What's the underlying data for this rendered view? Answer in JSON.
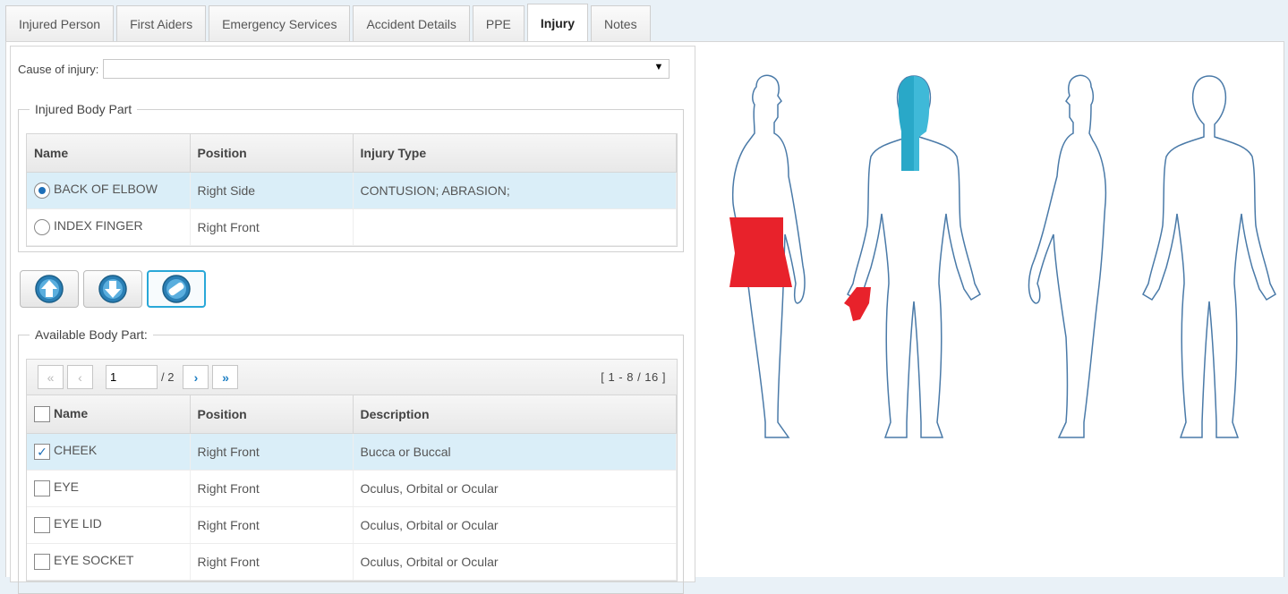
{
  "tabs": [
    {
      "label": "Injured Person"
    },
    {
      "label": "First Aiders"
    },
    {
      "label": "Emergency Services"
    },
    {
      "label": "Accident Details"
    },
    {
      "label": "PPE"
    },
    {
      "label": "Injury"
    },
    {
      "label": "Notes"
    }
  ],
  "cause": {
    "label": "Cause of injury:",
    "value": ""
  },
  "injured": {
    "legend": "Injured Body Part",
    "columns": [
      "Name",
      "Position",
      "Injury Type"
    ],
    "rows": [
      {
        "name": "BACK OF ELBOW",
        "position": "Right Side",
        "type": "CONTUSION; ABRASION;"
      },
      {
        "name": "INDEX FINGER",
        "position": "Right Front",
        "type": ""
      }
    ]
  },
  "buttons": {
    "up": "move-up",
    "down": "move-down",
    "edit": "edit"
  },
  "available": {
    "legend": "Available Body Part:",
    "pager": {
      "page": "1",
      "total": "/ 2",
      "range": "[ 1 - 8 / 16 ]"
    },
    "columns": [
      "Name",
      "Position",
      "Description"
    ],
    "rows": [
      {
        "name": "CHEEK",
        "position": "Right Front",
        "desc": "Bucca or Buccal"
      },
      {
        "name": "EYE",
        "position": "Right Front",
        "desc": "Oculus, Orbital or Ocular"
      },
      {
        "name": "EYE LID",
        "position": "Right Front",
        "desc": "Oculus, Orbital or Ocular"
      },
      {
        "name": "EYE SOCKET",
        "position": "Right Front",
        "desc": "Oculus, Orbital or Ocular"
      }
    ]
  },
  "colors": {
    "injured": "#e8222b",
    "selected": "#29a8c8",
    "accent": "#1d6fb8"
  }
}
